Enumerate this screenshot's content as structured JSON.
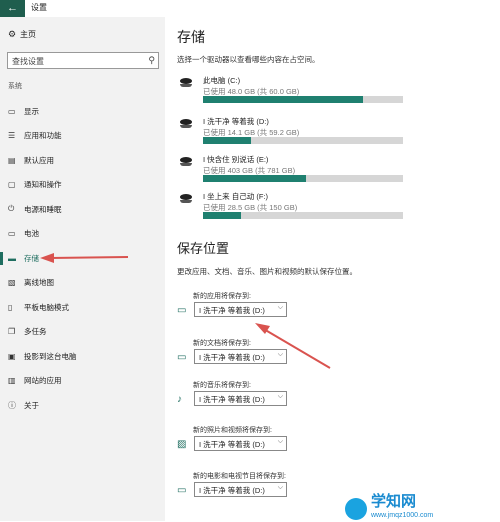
{
  "window": {
    "title": "设置"
  },
  "sidebar": {
    "home_label": "主页",
    "search_placeholder": "查找设置",
    "section_label": "系统",
    "items": [
      {
        "label": "显示",
        "icon": "monitor-icon"
      },
      {
        "label": "应用和功能",
        "icon": "apps-icon"
      },
      {
        "label": "默认应用",
        "icon": "default-apps-icon"
      },
      {
        "label": "通知和操作",
        "icon": "notification-icon"
      },
      {
        "label": "电源和睡眠",
        "icon": "power-icon"
      },
      {
        "label": "电池",
        "icon": "battery-icon"
      },
      {
        "label": "存储",
        "icon": "storage-icon",
        "active": true
      },
      {
        "label": "离线地图",
        "icon": "map-icon"
      },
      {
        "label": "平板电脑模式",
        "icon": "tablet-icon"
      },
      {
        "label": "多任务",
        "icon": "multitask-icon"
      },
      {
        "label": "投影到这台电脑",
        "icon": "project-icon"
      },
      {
        "label": "网站的应用",
        "icon": "web-apps-icon"
      },
      {
        "label": "关于",
        "icon": "info-icon"
      }
    ]
  },
  "storage": {
    "heading": "存储",
    "description": "选择一个驱动器以查看哪些内容在占空间。",
    "drives": [
      {
        "name": "此电脑 (C:)",
        "usage": "已使用 48.0 GB (共 60.0 GB)",
        "used_fraction": 0.8
      },
      {
        "name": "I 洗干净 等着我 (D:)",
        "usage": "已使用 14.1 GB (共 59.2 GB)",
        "used_fraction": 0.238
      },
      {
        "name": "I 快含住 别说话 (E:)",
        "usage": "已使用 403 GB (共 781 GB)",
        "used_fraction": 0.516
      },
      {
        "name": "I 坐上来 自己动 (F:)",
        "usage": "已使用 28.5 GB (共 150 GB)",
        "used_fraction": 0.19
      }
    ]
  },
  "save_locations": {
    "heading": "保存位置",
    "description": "更改应用、文档、音乐、图片和视频的默认保存位置。",
    "items": [
      {
        "label": "新的应用将保存到:",
        "value": "I 洗干净 等着我 (D:)",
        "icon": "monitor-icon"
      },
      {
        "label": "新的文档将保存到:",
        "value": "I 洗干净 等着我 (D:)",
        "icon": "folder-icon"
      },
      {
        "label": "新的音乐将保存到:",
        "value": "I 洗干净 等着我 (D:)",
        "icon": "music-note-icon"
      },
      {
        "label": "新的照片和视频将保存到:",
        "value": "I 洗干净 等着我 (D:)",
        "icon": "picture-icon"
      },
      {
        "label": "新的电影和电视节目将保存到:",
        "value": "I 洗干净 等着我 (D:)",
        "icon": "video-icon"
      }
    ]
  },
  "watermark": {
    "brand": "学知网",
    "url": "www.jmqz1000.com"
  },
  "colors": {
    "accent": "#1f6e60",
    "bar_fill": "#1f8070",
    "annotation_arrow": "#d9534f"
  }
}
